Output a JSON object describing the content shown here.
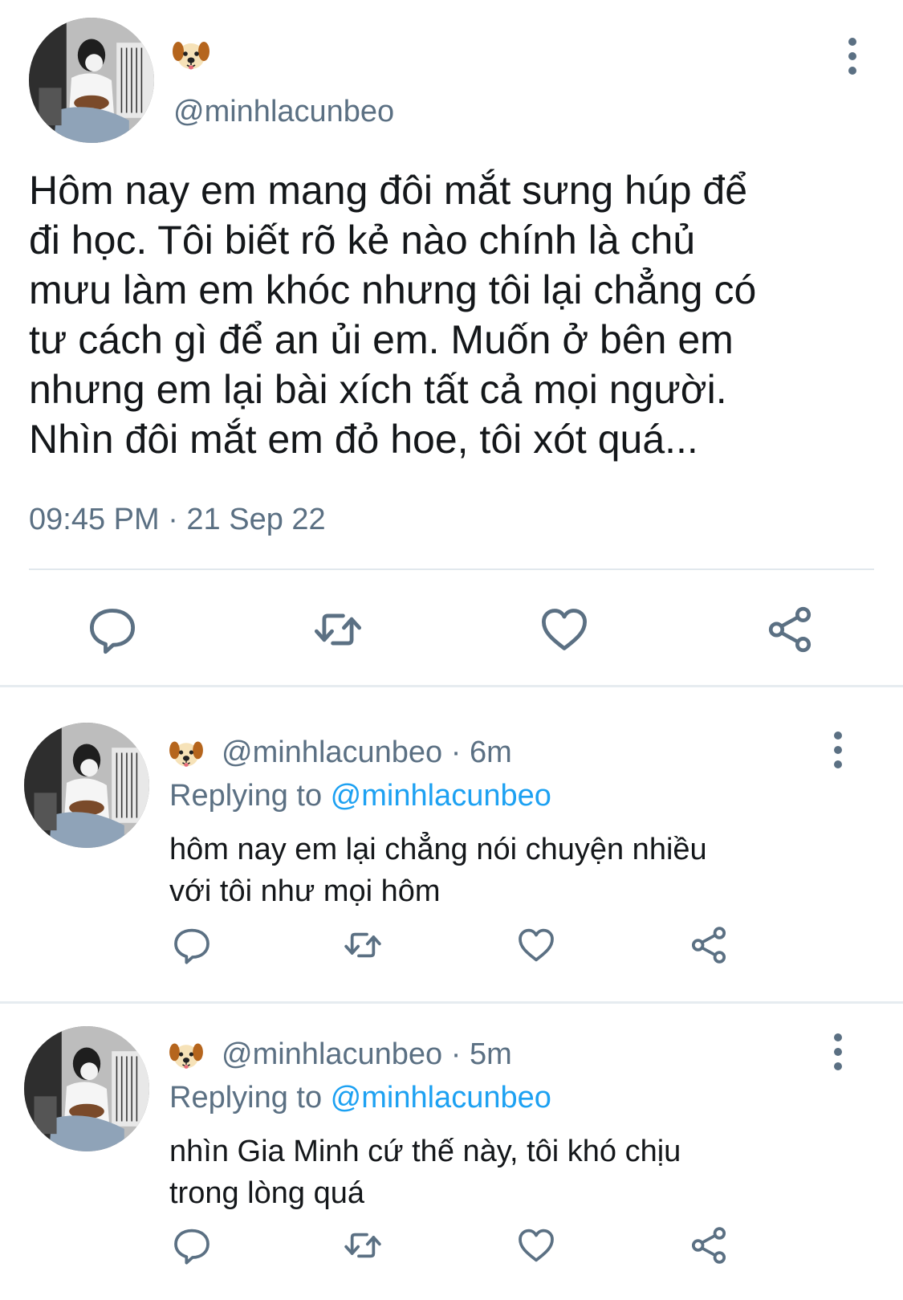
{
  "main_tweet": {
    "emoji": "🐶",
    "handle": "@minhlacunbeo",
    "text_lines": [
      "Hôm nay em mang đôi mắt sưng húp để",
      "đi học. Tôi biết rõ kẻ nào chính là chủ",
      "mưu làm em khóc nhưng tôi lại chẳng có",
      "tư cách gì để an ủi em. Muốn ở bên em",
      "nhưng em lại bài xích tất cả mọi người.",
      "Nhìn đôi mắt em đỏ hoe, tôi xót quá..."
    ],
    "timestamp": "09:45 PM · 21 Sep 22"
  },
  "replies": [
    {
      "handle_time": "@minhlacunbeo · 6m",
      "replying_prefix": "Replying to ",
      "replying_handle": "@minhlacunbeo",
      "text_lines": [
        "hôm nay em lại chẳng nói chuyện nhiều",
        "với tôi như mọi hôm"
      ]
    },
    {
      "handle_time": "@minhlacunbeo · 5m",
      "replying_prefix": "Replying to ",
      "replying_handle": "@minhlacunbeo",
      "text_lines": [
        "nhìn Gia Minh cứ thế này, tôi khó chịu",
        "trong lòng quá"
      ]
    }
  ],
  "icons": {
    "avatar": "user-avatar-photo",
    "emoji": "dog-face-emoji",
    "more": "more-vertical-icon",
    "reply": "reply-bubble-icon",
    "retweet": "retweet-icon",
    "like": "heart-icon",
    "share": "share-icon"
  },
  "colors": {
    "text_primary": "#14171a",
    "text_secondary": "#5b7083",
    "link": "#1da1f2",
    "divider": "#e6ecf0"
  }
}
